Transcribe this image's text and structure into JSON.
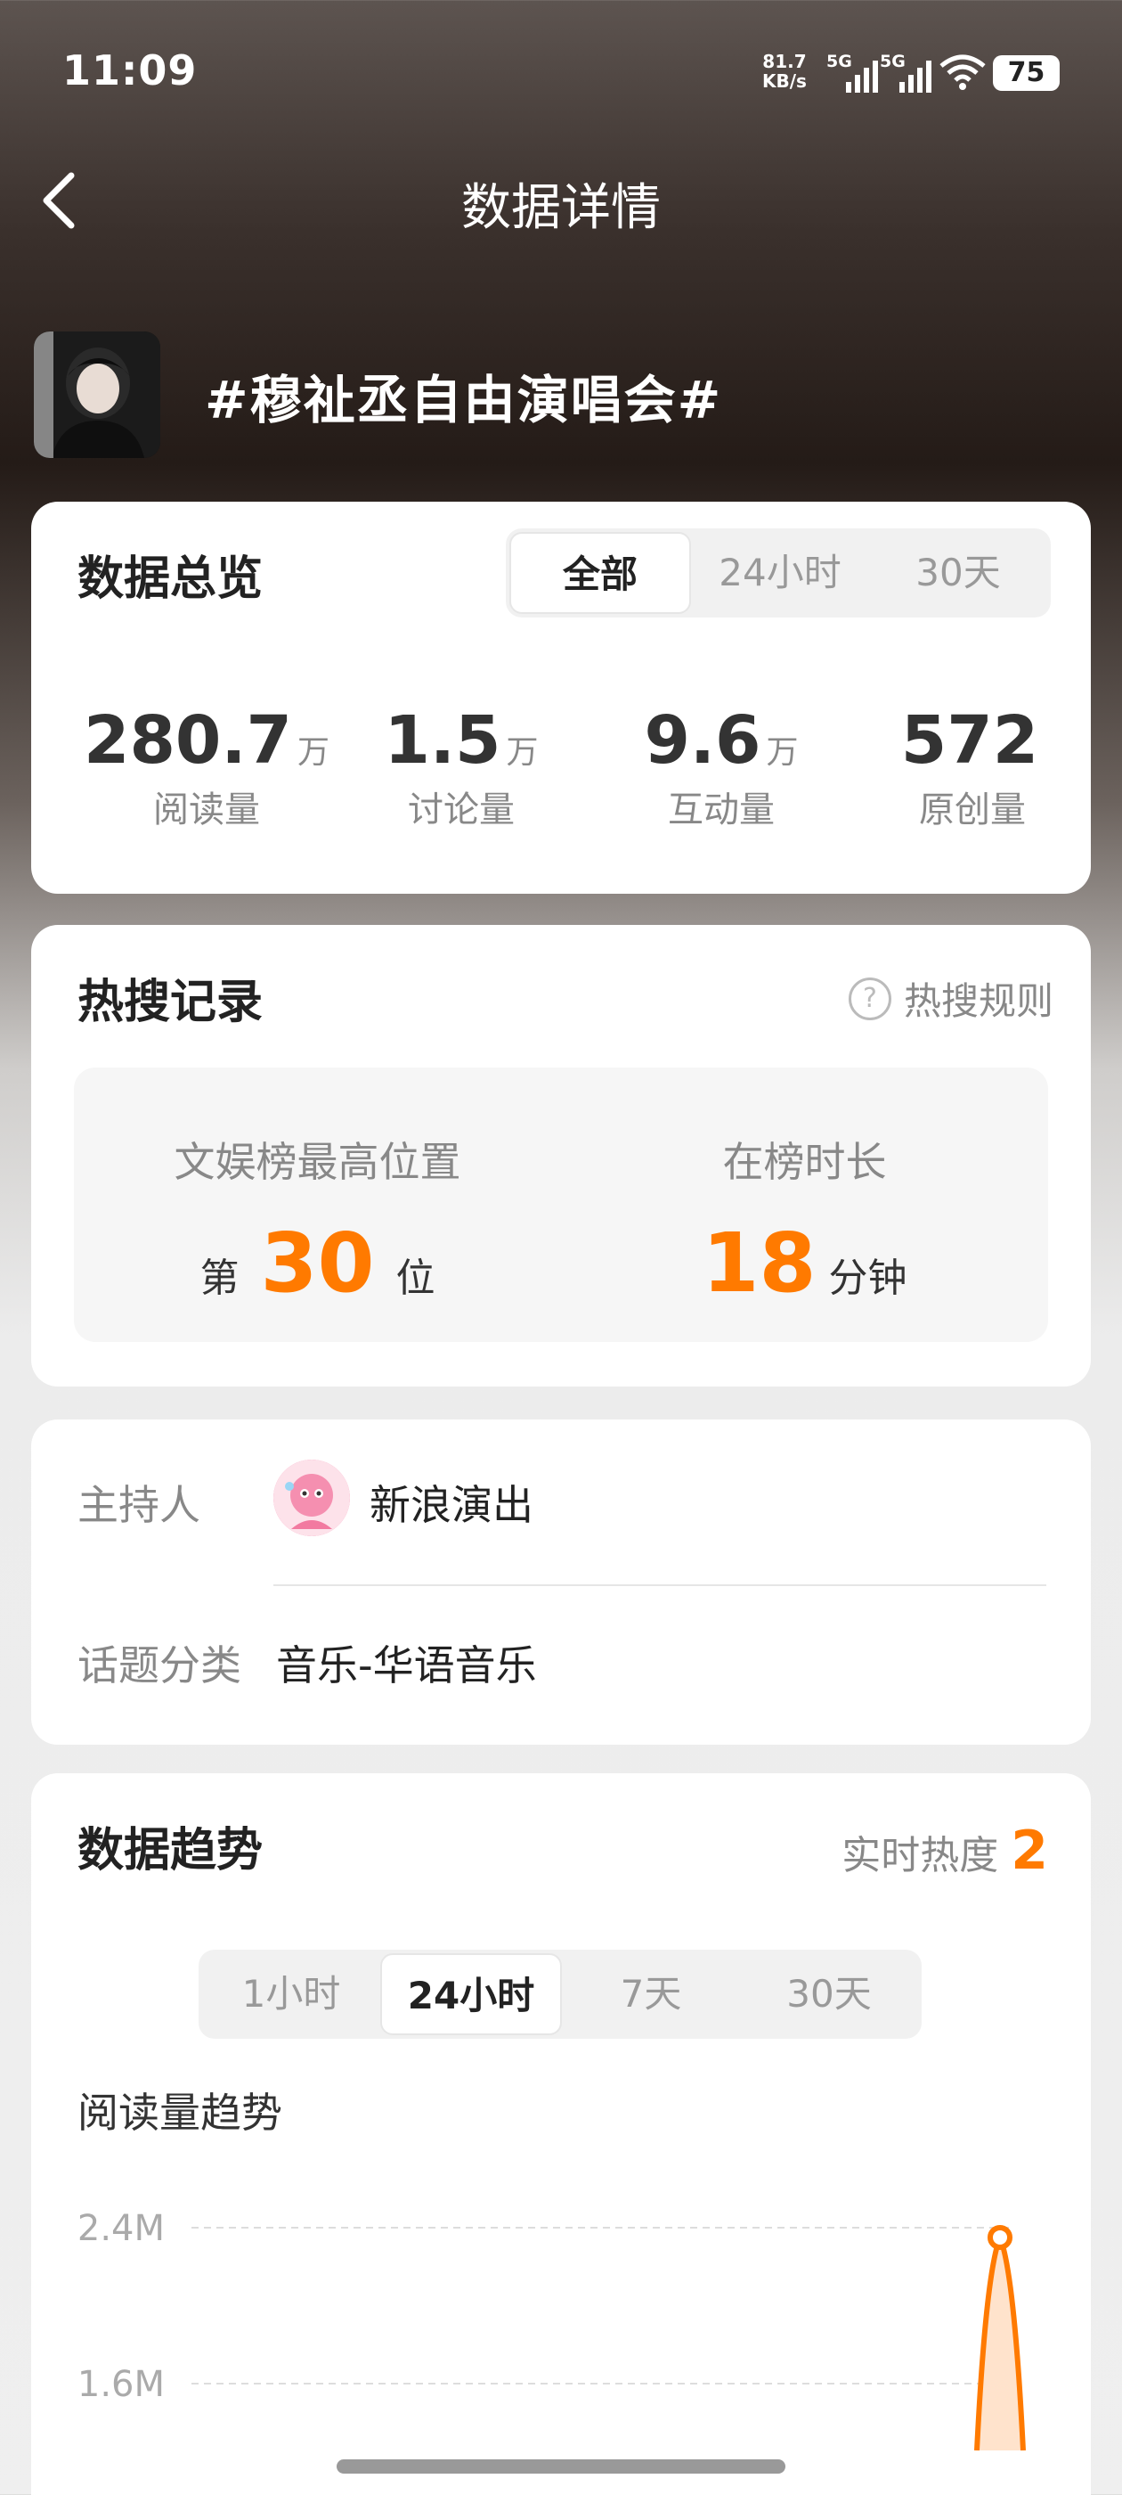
{
  "status_bar": {
    "time": "11:09",
    "net_speed_value": "81.7",
    "net_speed_unit": "KB/s",
    "signal1_label": "5G",
    "signal2_label": "5G",
    "battery": "75"
  },
  "nav": {
    "title": "数据详情"
  },
  "topic": {
    "title": "#穆祉丞自由演唱会#"
  },
  "overview": {
    "title": "数据总览",
    "tabs": [
      "全部",
      "24小时",
      "30天"
    ],
    "active_tab": "全部",
    "stats": [
      {
        "value": "280.7",
        "unit": "万",
        "label": "阅读量"
      },
      {
        "value": "1.5",
        "unit": "万",
        "label": "讨论量"
      },
      {
        "value": "9.6",
        "unit": "万",
        "label": "互动量"
      },
      {
        "value": "572",
        "unit": "",
        "label": "原创量"
      }
    ]
  },
  "hot_search": {
    "title": "热搜记录",
    "rule_link": "热搜规则",
    "highest_label": "文娱榜最高位置",
    "highest_prefix": "第",
    "highest_value": "30",
    "highest_suffix": "位",
    "duration_label": "在榜时长",
    "duration_value": "18",
    "duration_unit": "分钟"
  },
  "info": {
    "host_label": "主持人",
    "host_name": "新浪演出",
    "category_label": "话题分类",
    "category_value": "音乐-华语音乐"
  },
  "trend": {
    "title": "数据趋势",
    "heat_label": "实时热度",
    "heat_value": "2",
    "tabs": [
      "1小时",
      "24小时",
      "7天",
      "30天"
    ],
    "active_tab": "24小时",
    "chart_title": "阅读量趋势"
  },
  "chart_data": {
    "type": "line",
    "title": "阅读量趋势",
    "y_tick_labels": [
      "2.4M",
      "1.6M"
    ],
    "y_ticks": [
      2400000,
      1600000
    ],
    "ylim": [
      1600000,
      2400000
    ],
    "grid": true,
    "series": [
      {
        "values": [
          1500000,
          2350000,
          1500000
        ]
      }
    ],
    "colors": {
      "line": "#ff7a00",
      "fill": "#ffe3cc"
    }
  },
  "colors": {
    "accent": "#ff7a00"
  }
}
